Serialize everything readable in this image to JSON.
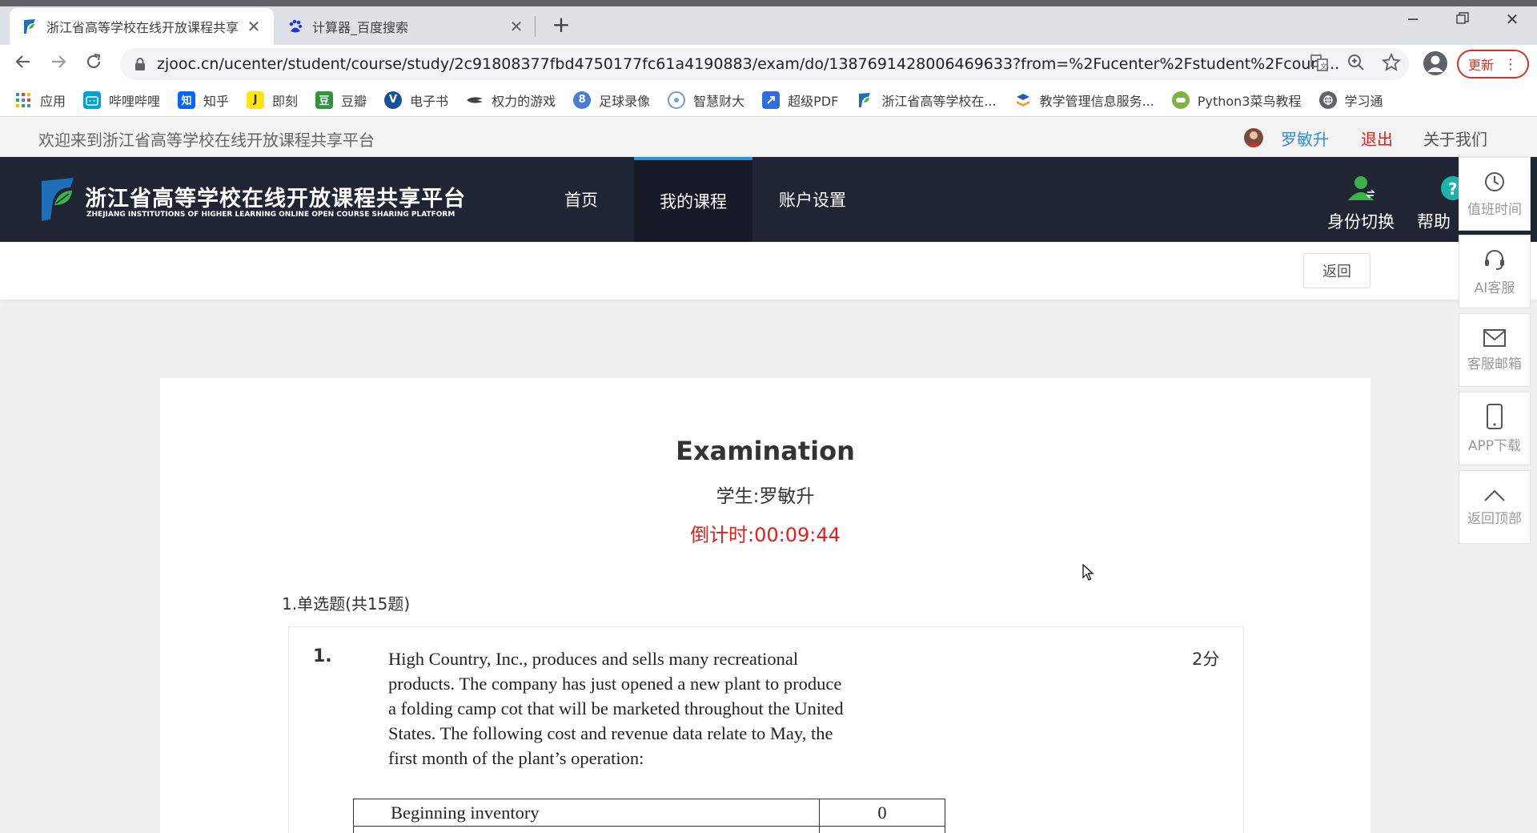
{
  "browser": {
    "tabs": [
      {
        "title": "浙江省高等学校在线开放课程共享",
        "active": true
      },
      {
        "title": "计算器_百度搜索",
        "active": false
      }
    ],
    "url": "zjooc.cn/ucenter/student/course/study/2c91808377fbd4750177fc61a4190883/exam/do/1387691428006469633?from=%2Fucenter%2Fstudent%2Fcours...",
    "update_label": "更新",
    "bookmarks": [
      {
        "label": "应用",
        "icon": "apps-grid-icon",
        "color": "#4285f4"
      },
      {
        "label": "哔哩哔哩",
        "icon": "bilibili-icon",
        "color": "#00a1d6"
      },
      {
        "label": "知乎",
        "icon": "zhihu-icon",
        "color": "#0066ff"
      },
      {
        "label": "即刻",
        "icon": "jike-icon",
        "color": "#ffe411"
      },
      {
        "label": "豆瓣",
        "icon": "douban-icon",
        "color": "#2d963d"
      },
      {
        "label": "电子书",
        "icon": "vbook-icon",
        "color": "#1a4fa0"
      },
      {
        "label": "权力的游戏",
        "icon": "got-icon",
        "color": "#444444"
      },
      {
        "label": "足球录像",
        "icon": "football-icon",
        "color": "#4a7bd6"
      },
      {
        "label": "智慧财大",
        "icon": "university-icon",
        "color": "#7a9ad8"
      },
      {
        "label": "超级PDF",
        "icon": "pdf-icon",
        "color": "#2f6ed8"
      },
      {
        "label": "浙江省高等学校在...",
        "icon": "zjooc-icon",
        "color": "#1e6fb8"
      },
      {
        "label": "教学管理信息服务...",
        "icon": "jwxt-icon",
        "color": "#2a5ab0"
      },
      {
        "label": "Python3菜鸟教程",
        "icon": "runoob-icon",
        "color": "#7cb342"
      },
      {
        "label": "学习通",
        "icon": "xuexitong-icon",
        "color": "#5f6368"
      }
    ]
  },
  "site": {
    "welcome": "欢迎来到浙江省高等学校在线开放课程共享平台",
    "username": "罗敏升",
    "logout": "退出",
    "about": "关于我们",
    "logo_cn": "浙江省高等学校在线开放课程共享平台",
    "logo_en": "ZHEJIANG INSTITUTIONS OF HIGHER LEARNING ONLINE OPEN COURSE SHARING PLATFORM",
    "nav": [
      {
        "label": "首页",
        "active": false
      },
      {
        "label": "我的课程",
        "active": true
      },
      {
        "label": "账户设置",
        "active": false
      }
    ],
    "identity_switch": "身份切换",
    "help": "帮助",
    "back": "返回",
    "side_tools": [
      "值班时间",
      "AI客服",
      "客服邮箱",
      "APP下载",
      "返回顶部"
    ]
  },
  "exam": {
    "title": "Examination",
    "student": "学生:罗敏升",
    "timer": "倒计时:00:09:44",
    "section": "1.单选题(共15题)",
    "question": {
      "number": "1.",
      "score": "2分",
      "text": "High Country, Inc., produces and sells many recreational products. The company has just opened a new plant to produce a folding camp cot that will be marketed throughout the United States. The following cost and revenue data relate to May, the first month of the plant’s operation:",
      "table": [
        {
          "label": "Beginning inventory",
          "value": "0"
        }
      ]
    }
  }
}
